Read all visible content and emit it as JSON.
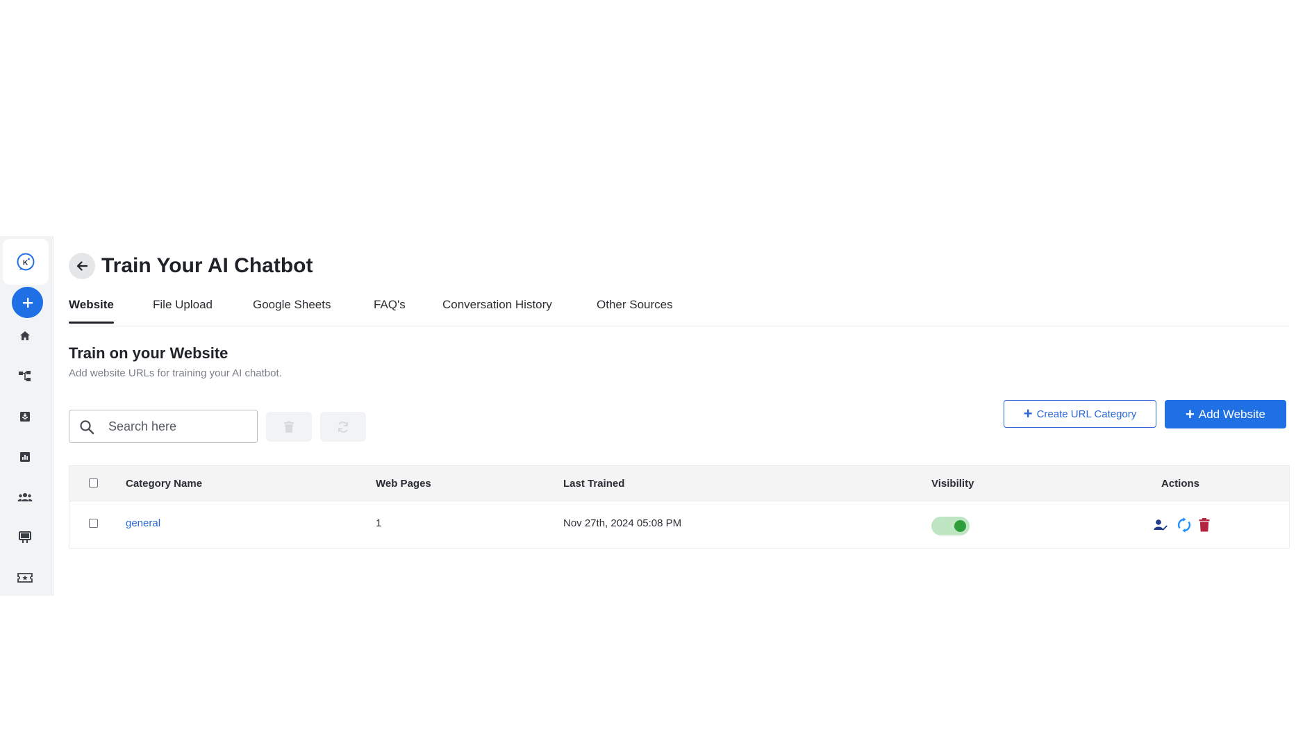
{
  "sidebar": {
    "logo_letter": "K",
    "icons": [
      "home-icon",
      "flow-icon",
      "inbox-icon",
      "analytics-icon",
      "team-icon",
      "billboard-icon",
      "ticket-icon"
    ]
  },
  "header": {
    "title": "Train Your AI Chatbot"
  },
  "tabs": [
    {
      "label": "Website",
      "active": true
    },
    {
      "label": "File Upload",
      "active": false
    },
    {
      "label": "Google Sheets",
      "active": false
    },
    {
      "label": "FAQ's",
      "active": false
    },
    {
      "label": "Conversation History",
      "active": false
    },
    {
      "label": "Other Sources",
      "active": false
    }
  ],
  "section": {
    "title": "Train on your Website",
    "subtitle": "Add website URLs for training your AI chatbot."
  },
  "search": {
    "placeholder": "Search here",
    "value": ""
  },
  "buttons": {
    "create_category": "Create URL Category",
    "add_website": "Add Website"
  },
  "table": {
    "columns": [
      "Category Name",
      "Web Pages",
      "Last Trained",
      "Visibility",
      "Actions"
    ],
    "rows": [
      {
        "category_name": "general",
        "web_pages": "1",
        "last_trained": "Nov 27th, 2024 05:08 PM",
        "visible": true
      }
    ]
  },
  "colors": {
    "primary": "#1f6fe5",
    "link": "#2a66d9",
    "toggle_on": "#2e9e3c",
    "danger": "#b3243f",
    "assign": "#1e3a8a",
    "retrain": "#1e90ff"
  }
}
